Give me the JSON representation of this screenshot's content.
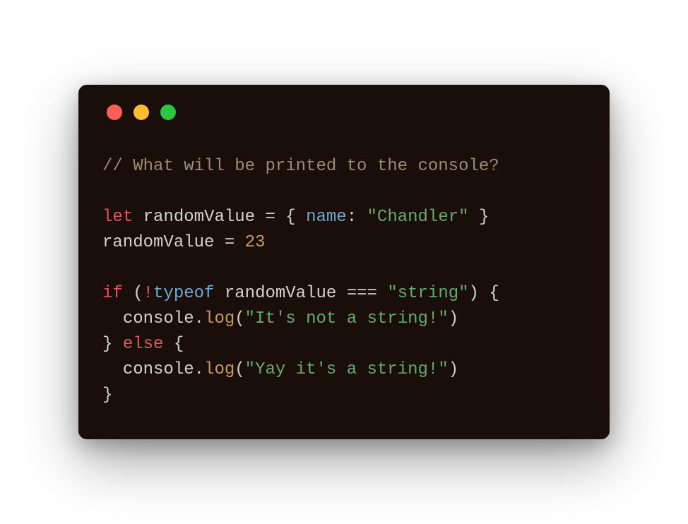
{
  "window": {
    "traffic_lights": {
      "red": "close",
      "yellow": "minimize",
      "green": "maximize"
    }
  },
  "code": {
    "line1_comment": "// What will be printed to the console?",
    "line3_let": "let",
    "line3_var": "randomValue",
    "line3_eq": " = ",
    "line3_lbrace": "{ ",
    "line3_name": "name",
    "line3_colon": ": ",
    "line3_value": "\"Chandler\"",
    "line3_rbrace": " }",
    "line4_var": "randomValue",
    "line4_eq": " = ",
    "line4_num": "23",
    "line6_if": "if",
    "line6_sp_lp": " (",
    "line6_bang": "!",
    "line6_typeof": "typeof",
    "line6_sp1": " ",
    "line6_var": "randomValue",
    "line6_eqeqeq": " === ",
    "line6_str": "\"string\"",
    "line6_rp_lb": ") {",
    "line7_indent": "  ",
    "line7_console": "console",
    "line7_dot": ".",
    "line7_log": "log",
    "line7_lp": "(",
    "line7_str": "\"It's not a string!\"",
    "line7_rp": ")",
    "line8_rb": "} ",
    "line8_else": "else",
    "line8_lb": " {",
    "line9_indent": "  ",
    "line9_console": "console",
    "line9_dot": ".",
    "line9_log": "log",
    "line9_lp": "(",
    "line9_str": "\"Yay it's a string!\"",
    "line9_rp": ")",
    "line10_rb": "}"
  },
  "colors": {
    "background": "#1a0e0a",
    "comment": "#9b8b77",
    "keyword": "#e15663",
    "identifier": "#d6d2ca",
    "property": "#71a8d1",
    "string": "#67a96f",
    "number": "#c79a5a",
    "method": "#c79a5a"
  }
}
